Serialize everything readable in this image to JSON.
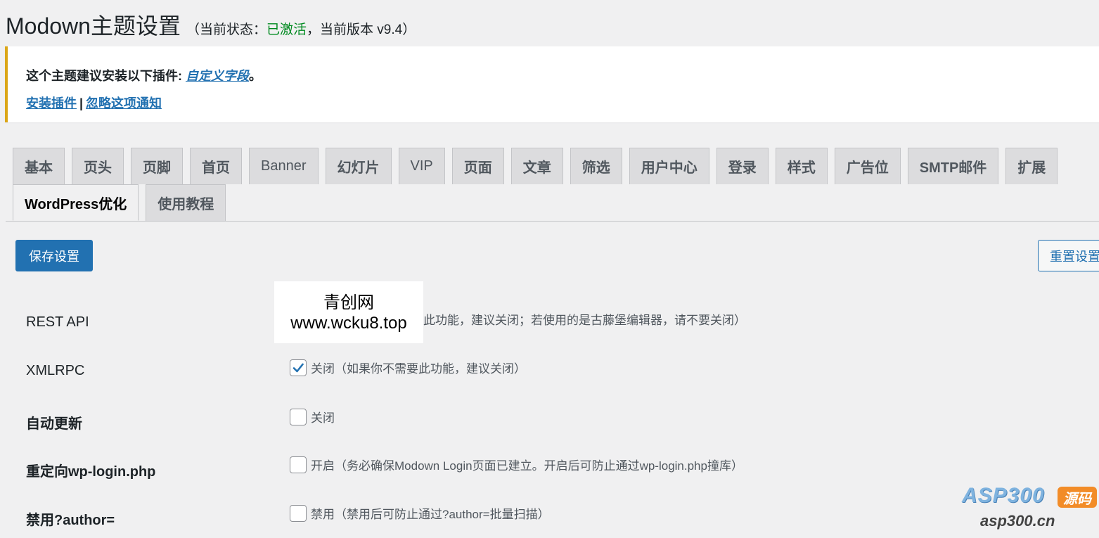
{
  "header": {
    "title": "Modown主题设置",
    "meta_prefix": "（当前状态：",
    "meta_status": "已激活",
    "meta_suffix": "，当前版本 v9.4）"
  },
  "notice": {
    "text": "这个主题建议安装以下插件: ",
    "plugin_link": "自定义字段",
    "period": "。",
    "install_link": "安装插件",
    "separator": "|",
    "dismiss_link": "忽略这项通知"
  },
  "tabs_row1": [
    "基本",
    "页头",
    "页脚",
    "首页",
    "Banner",
    "幻灯片",
    "VIP",
    "页面",
    "文章",
    "筛选",
    "用户中心",
    "登录",
    "样式",
    "广告位",
    "SMTP邮件",
    "扩展"
  ],
  "tabs_row2": [
    "WordPress优化",
    "使用教程"
  ],
  "active_tab": "WordPress优化",
  "buttons": {
    "save": "保存设置",
    "reset": "重置设置"
  },
  "settings": [
    {
      "label": "REST API",
      "checked": false,
      "field_text": "此功能，建议关闭；若使用的是古藤堡编辑器，请不要关闭）"
    },
    {
      "label": "XMLRPC",
      "checked": true,
      "field_text": "关闭（如果你不需要此功能，建议关闭）"
    },
    {
      "label": "自动更新",
      "checked": false,
      "field_text": "关闭"
    },
    {
      "label": "重定向wp-login.php",
      "checked": false,
      "field_text": "开启（务必确保Modown Login页面已建立。开启后可防止通过wp-login.php撞库）"
    },
    {
      "label": "禁用?author=",
      "checked": false,
      "field_text": "禁用（禁用后可防止通过?author=批量扫描）"
    }
  ],
  "watermark": {
    "line1": "青创网",
    "line2": "www.wcku8.top"
  },
  "corner_logo": {
    "brand": "ASP300",
    "badge": "源码",
    "url": "asp300.cn"
  },
  "colors": {
    "accent": "#2271b1",
    "active_status": "#008a20",
    "notice_border": "#dba617"
  }
}
